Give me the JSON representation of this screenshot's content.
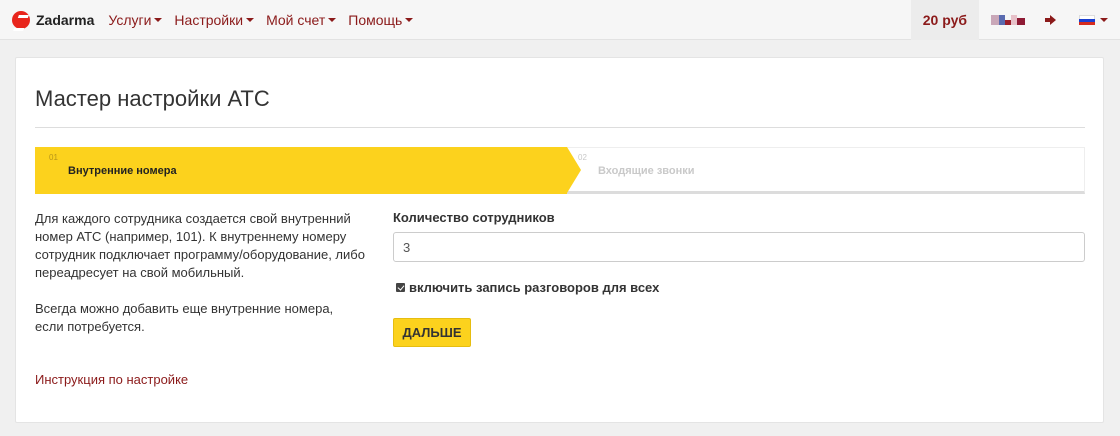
{
  "navbar": {
    "brand": "Zadarma",
    "menu": [
      {
        "label": "Услуги"
      },
      {
        "label": "Настройки"
      },
      {
        "label": "Мой счет"
      },
      {
        "label": "Помощь"
      }
    ],
    "balance": "20 руб"
  },
  "page": {
    "title": "Мастер настройки АТС"
  },
  "wizard": {
    "steps": [
      {
        "num": "01",
        "label": "Внутренние номера",
        "active": true
      },
      {
        "num": "02",
        "label": "Входящие звонки",
        "active": false
      }
    ]
  },
  "description": {
    "p1": "Для каждого сотрудника создается свой внутренний номер АТС (например, 101). К внутреннему номеру сотрудник подключает программу/оборудование, либо переадресует на свой мобильный.",
    "p2": "Всегда можно добавить еще внутренние номера, если потребуется.",
    "link": "Инструкция по настройке"
  },
  "form": {
    "employees_label": "Количество сотрудников",
    "employees_value": "3",
    "record_label": "включить запись разговоров для всех",
    "record_checked": true,
    "next_label": "ДАЛЬШЕ"
  },
  "colors": {
    "accent": "#fcd21d",
    "link": "#8b1a1a",
    "brand_red": "#e8251c"
  }
}
